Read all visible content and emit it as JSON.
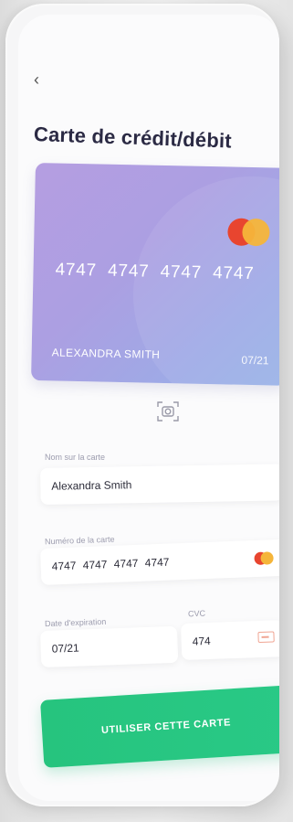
{
  "header": {
    "back_icon": "chevron-left-icon",
    "title": "Carte de crédit/débit"
  },
  "card": {
    "number": "4747 4747 4747 4747",
    "holder": "ALEXANDRA SMITH",
    "expiry": "07/21",
    "brand_icon": "mastercard-logo-icon",
    "colors": {
      "gradient_start": "#b59ee1",
      "gradient_end": "#98b2e8"
    }
  },
  "scan": {
    "icon": "camera-scan-icon"
  },
  "form": {
    "name": {
      "label": "Nom sur la carte",
      "value": "Alexandra Smith"
    },
    "number": {
      "label": "Numéro de la carte",
      "value": "4747  4747  4747  4747"
    },
    "expiry": {
      "label": "Date d'expiration",
      "value": "07/21"
    },
    "cvc": {
      "label": "CVC",
      "value": "474"
    }
  },
  "cta": {
    "label": "UTILISER CETTE CARTE",
    "color": "#26c47e"
  }
}
